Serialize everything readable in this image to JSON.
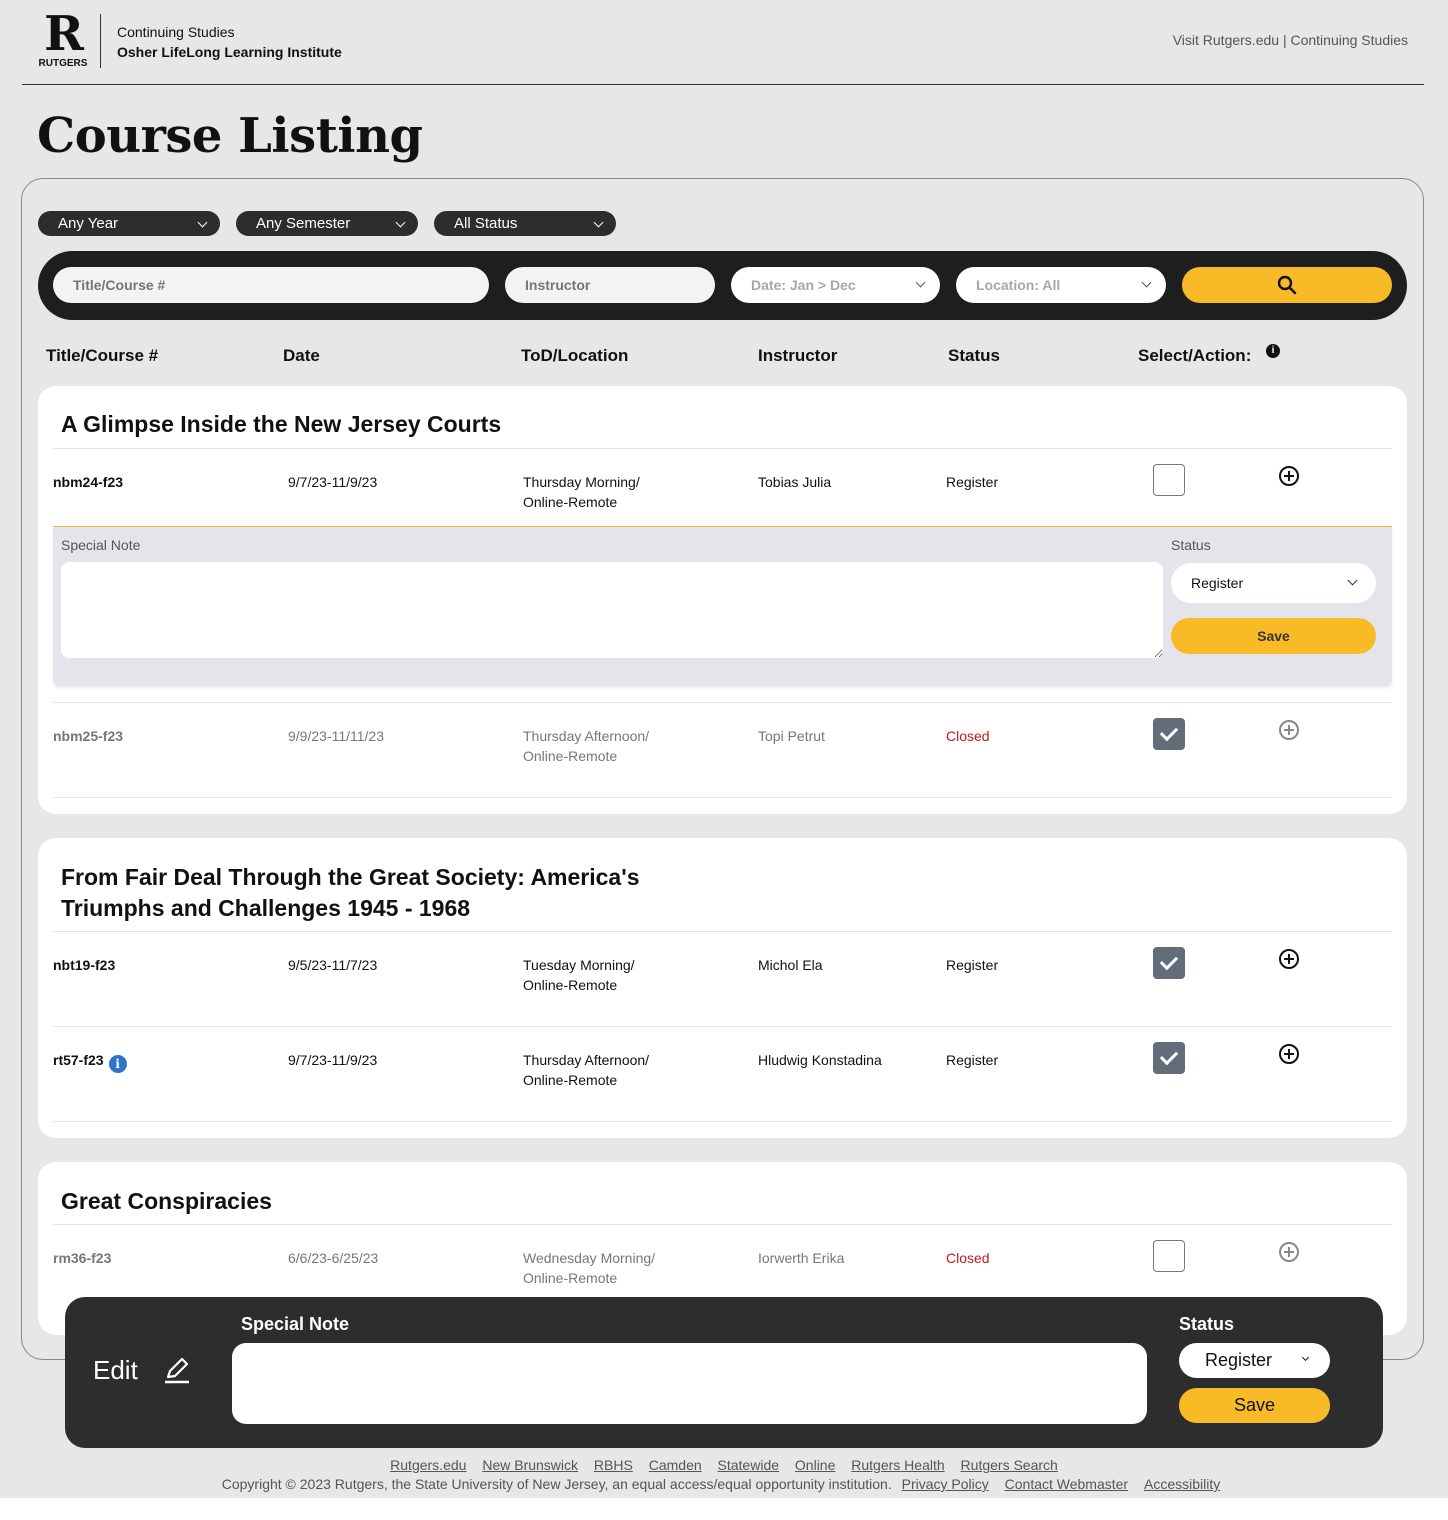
{
  "header": {
    "logo_letter": "R",
    "logo_word": "RUTGERS",
    "org_line1": "Continuing Studies",
    "org_line2": "Osher LifeLong Learning Institute",
    "top_links": "Visit Rutgers.edu | Continuing Studies"
  },
  "page_title": "Course Listing",
  "filters": {
    "year": "Any Year",
    "semester": "Any Semester",
    "status": "All Status"
  },
  "search": {
    "title_placeholder": "Title/Course #",
    "instructor_placeholder": "Instructor",
    "date": "Date: Jan > Dec",
    "location": "Location: All",
    "button_icon": "search-icon"
  },
  "columns": [
    "Title/Course #",
    "Date",
    "ToD/Location",
    "Instructor",
    "Status",
    "Select/Action:"
  ],
  "courses": [
    {
      "title": "A Glimpse Inside the New Jersey Courts",
      "sections": [
        {
          "code": "nbm24-f23",
          "date": "9/7/23-11/9/23",
          "tod": "Thursday Morning/",
          "location": "Online-Remote",
          "instructor": "Tobias Julia",
          "status": "Register",
          "checked": false
        },
        {
          "code": "nbm25-f23",
          "date": "9/9/23-11/11/23",
          "tod": "Thursday Afternoon/",
          "location": "Online-Remote",
          "instructor": "Topi Petrut",
          "status": "Closed",
          "checked": true
        }
      ]
    },
    {
      "title_line1": "From Fair Deal Through the Great Society: America's",
      "title_line2": "Triumphs and Challenges 1945 - 1968",
      "sections": [
        {
          "code": "nbt19-f23",
          "date": "9/5/23-11/7/23",
          "tod": "Tuesday Morning/",
          "location": "Online-Remote",
          "instructor": "Michol Ela",
          "status": "Register",
          "checked": true
        },
        {
          "code": "rt57-f23",
          "date": "9/7/23-11/9/23",
          "tod": "Thursday Afternoon/",
          "location": "Online-Remote",
          "instructor": "Hludwig Konstadina",
          "status": "Register",
          "checked": true
        }
      ]
    },
    {
      "title": "Great Conspiracies",
      "sections": [
        {
          "code": "rm36-f23",
          "date": "6/6/23-6/25/23",
          "tod": "Wednesday Morning/",
          "location": "Online-Remote",
          "instructor": "Iorwerth Erika",
          "status": "Closed",
          "checked": false
        }
      ]
    }
  ],
  "note_panel": {
    "note_label": "Special Note",
    "status_label": "Status",
    "status_value": "Register",
    "save_label": "Save"
  },
  "dock": {
    "edit_label": "Edit",
    "note_label": "Special Note",
    "status_label": "Status",
    "status_value": "Register",
    "save_label": "Save"
  },
  "footer": {
    "links": [
      "Rutgers.edu",
      "New Brunswick",
      "RBHS",
      "Camden",
      "Statewide",
      "Online",
      "Rutgers Health",
      "Rutgers Search"
    ],
    "copyright": "Copyright © 2023 Rutgers, the State University of New Jersey, an equal access/equal opportunity institution.",
    "links2": [
      "Privacy Policy",
      "Contact Webmaster",
      "Accessibility"
    ]
  },
  "colors": {
    "accent": "#f8bb27",
    "dark": "#2d2d2d",
    "closed": "#c21b1b",
    "checked": "#636c79",
    "info": "#2f73c9"
  }
}
